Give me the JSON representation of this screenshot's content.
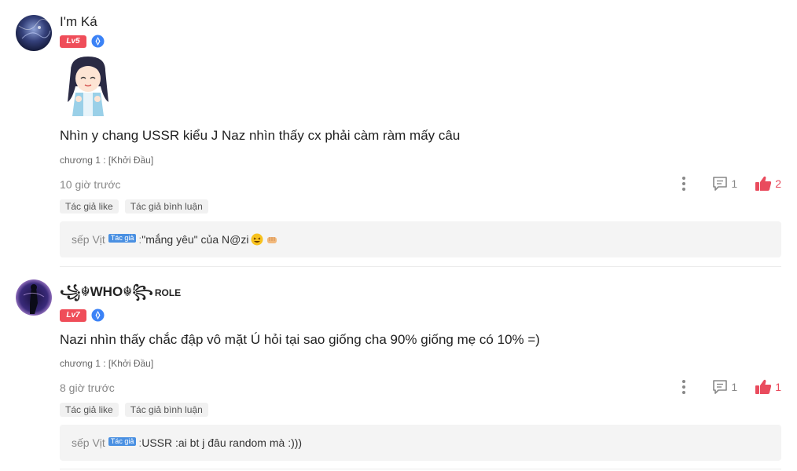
{
  "comments": [
    {
      "username": "I'm Ká",
      "level": "Lv5",
      "content": "Nhìn y chang USSR kiểu J Naz nhìn thấy cx phải càm ràm mấy câu",
      "chapter": "chương 1 : [Khởi Đầu]",
      "time": "10 giờ trước",
      "reply_count": "1",
      "like_count": "2",
      "tags": [
        "Tác giả like",
        "Tác giả bình luận"
      ],
      "reply": {
        "author": "sếp Vịt",
        "author_badge": "Tác giả",
        "separator": " : ",
        "text": "\"mắng yêu\" của N@zi"
      }
    },
    {
      "username": "꧁☬WHO☬꧂",
      "username_suffix": "ROLE",
      "level": "Lv7",
      "content": "Nazi nhìn thấy chắc đập vô mặt Ú hỏi tại sao giống cha 90% giống mẹ có 10% =)",
      "chapter": "chương 1 : [Khởi Đầu]",
      "time": "8 giờ trước",
      "reply_count": "1",
      "like_count": "1",
      "tags": [
        "Tác giả like",
        "Tác giả bình luận"
      ],
      "reply": {
        "author": "sếp Vịt",
        "author_badge": "Tác giả",
        "separator": " : ",
        "text": "USSR :ai bt j đâu random mà :)))"
      }
    }
  ],
  "colors": {
    "accent_red": "#e94b5d",
    "level_badge": "#ef4d59",
    "author_badge": "#4a90e2",
    "verify_blue": "#3b82f6"
  }
}
